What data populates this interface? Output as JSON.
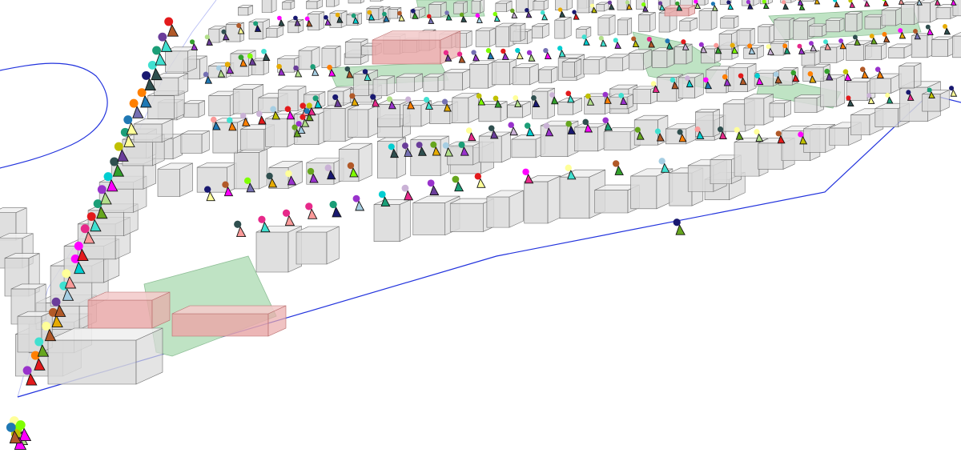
{
  "scene": {
    "background": "#ffffff",
    "building_fill": "#d9d9d9",
    "building_top": "#f0f0f0",
    "building_stroke": "#6e6e6e",
    "park_fill": "#bfe3c4",
    "park_stroke": "#8fbf97",
    "special_fill": "#e9a9a9",
    "special_stroke": "#b86c6c",
    "boundary_stroke": "#2233dd",
    "agent_colors": [
      "#e31a1c",
      "#1f78b4",
      "#33a02c",
      "#6a3d9a",
      "#ff7f00",
      "#b15928",
      "#a6cee3",
      "#b2df8a",
      "#fb9a99",
      "#cab2d6",
      "#ffff99",
      "#e7298a",
      "#1b9e77",
      "#7570b3",
      "#66a61e",
      "#e6ab02",
      "#00ced1",
      "#ff00ff",
      "#7fff00",
      "#9932cc",
      "#2f4f4f",
      "#191970",
      "#c0c000",
      "#40e0d0"
    ]
  }
}
